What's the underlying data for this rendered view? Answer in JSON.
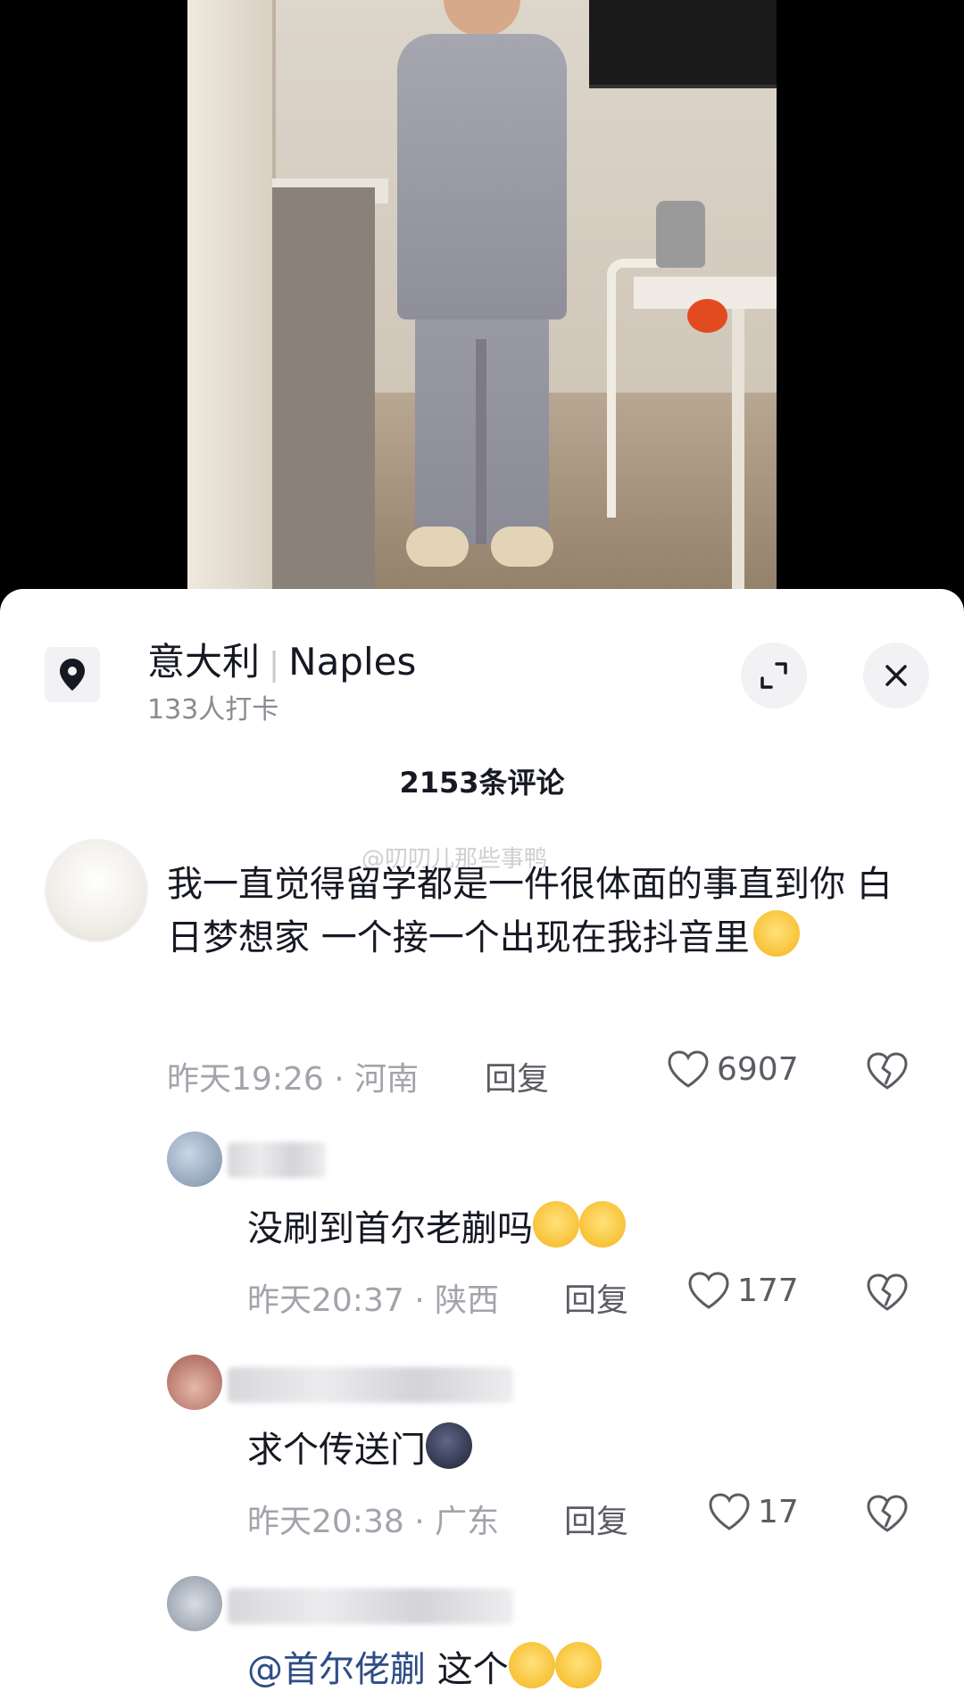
{
  "location": {
    "country": "意大利",
    "separator": "|",
    "city": "Naples",
    "checkins": "133人打卡"
  },
  "comments_header": "2153条评论",
  "watermark": "@叨叨儿那些事鸭",
  "comments": [
    {
      "text": "我一直觉得留学都是一件很体面的事直到你 白日梦想家 一个接一个出现在我抖音里",
      "time_place": "昨天19:26 · 河南",
      "reply_label": "回复",
      "likes": "6907"
    },
    {
      "text": "没刷到首尔老蒯吗",
      "time_place": "昨天20:37 · 陕西",
      "reply_label": "回复",
      "likes": "177"
    },
    {
      "text": "求个传送门",
      "time_place": "昨天20:38 · 广东",
      "reply_label": "回复",
      "likes": "17"
    },
    {
      "mention": "@首尔佬蒯",
      "text": " 这个"
    }
  ],
  "icons": {
    "location": "location-pin-icon",
    "expand": "expand-icon",
    "close": "close-icon",
    "like": "heart-outline-icon",
    "dislike": "broken-heart-icon"
  },
  "colors": {
    "sheet_bg": "#ffffff",
    "primary_text": "#161823",
    "secondary_text": "#a3a4ab",
    "mention": "#2e4d86"
  }
}
